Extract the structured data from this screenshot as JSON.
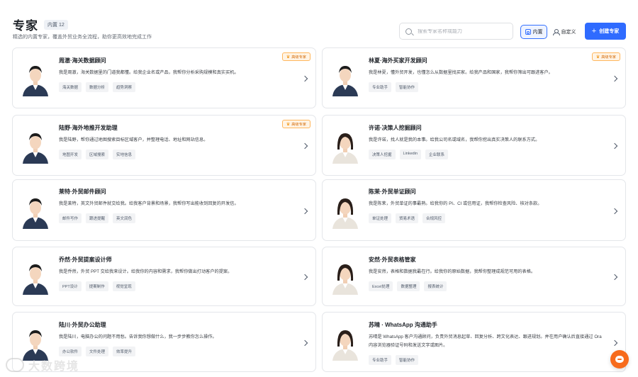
{
  "header": {
    "title": "专家",
    "count_badge": "内置 12",
    "subtitle": "精选的内置专家，覆盖外贸业务全流程，助你更高效地完成工作",
    "search_placeholder": "搜索专家名称或能力",
    "filter_builtin": "内置",
    "filter_custom": "自定义",
    "create_button": "创建专家"
  },
  "recommend_label": "高级专家",
  "experts": [
    {
      "name": "周澈·海关数据顾问",
      "desc": "我是周澈，海关数据里的门道我都懂。给我企业名或产品，我帮你分析采购规模和真实买机。",
      "tags": [
        "海关数据",
        "数据分析",
        "趋势洞察"
      ],
      "recommended": true,
      "gender": "m"
    },
    {
      "name": "林夏·海外买家开发顾问",
      "desc": "我是林夏，懂外贸开发，也懂怎么从数据里找买家。给我产品和国家，我帮你筛出可跟进客户。",
      "tags": [
        "专业助手",
        "智能协作"
      ],
      "recommended": true,
      "gender": "m"
    },
    {
      "name": "陆野·海外地推开发助理",
      "desc": "我是陆野，帮你通过地图搜索目标区域客户，并整理电话、地址和网站信息。",
      "tags": [
        "地图开发",
        "区域搜索",
        "实地信息"
      ],
      "recommended": true,
      "gender": "m"
    },
    {
      "name": "许诺·决策人挖掘顾问",
      "desc": "我是许诺，找人就是我的本事。给我公司名或域名，我帮你挖出真实决策人的联系方式。",
      "tags": [
        "决策人挖掘",
        "Linkedin",
        "企业联系"
      ],
      "recommended": false,
      "gender": "f"
    },
    {
      "name": "莱特·外贸邮件顾问",
      "desc": "我是莱特，英文外贸邮件就交给我。给我客户背景和场景，我帮你写出能收到回复的开发信。",
      "tags": [
        "邮件写作",
        "跟进提醒",
        "英文润色"
      ],
      "recommended": false,
      "gender": "m"
    },
    {
      "name": "陈茉·外贸单证顾问",
      "desc": "我是陈茉，外贸单证的事最熟。给我你的 PI、CI 或信用证，我帮你检查风险、核对条款。",
      "tags": [
        "单证处理",
        "贸易术语",
        "合规风控"
      ],
      "recommended": false,
      "gender": "f"
    },
    {
      "name": "乔然·外贸提案设计师",
      "desc": "我是乔然，外贸 PPT 交给我来设计。给我你的内容和需求，我帮你做出打动客户的提案。",
      "tags": [
        "PPT设计",
        "提案制作",
        "视觉呈现"
      ],
      "recommended": false,
      "gender": "m"
    },
    {
      "name": "安然·外贸表格管家",
      "desc": "我是安然，表格和数据我最在行。给我你的原始数据，我帮你整理成规范可用的表格。",
      "tags": [
        "Excel处理",
        "数据整理",
        "报表统计"
      ],
      "recommended": false,
      "gender": "f"
    },
    {
      "name": "陆川·外贸办公助理",
      "desc": "我是陆川，电脑办公的问题不用愁。告诉我你想做什么，我一步步教你怎么操作。",
      "tags": [
        "办公软件",
        "文件处理",
        "效率提升"
      ],
      "recommended": false,
      "gender": "m"
    },
    {
      "name": "苏晴 · WhatsApp 沟通助手",
      "desc": "苏晴是 WhatsApp 客户沟通顾问，负责外贸消息起草、回复分析、跨文化表达、跟进规划。并在用户确认后直接通过 Ora 内容浏览器验证号码和发送文字或图片。",
      "tags": [
        "专业助手",
        "智能协作"
      ],
      "recommended": false,
      "gender": "f"
    }
  ],
  "watermark": "大数跨境"
}
